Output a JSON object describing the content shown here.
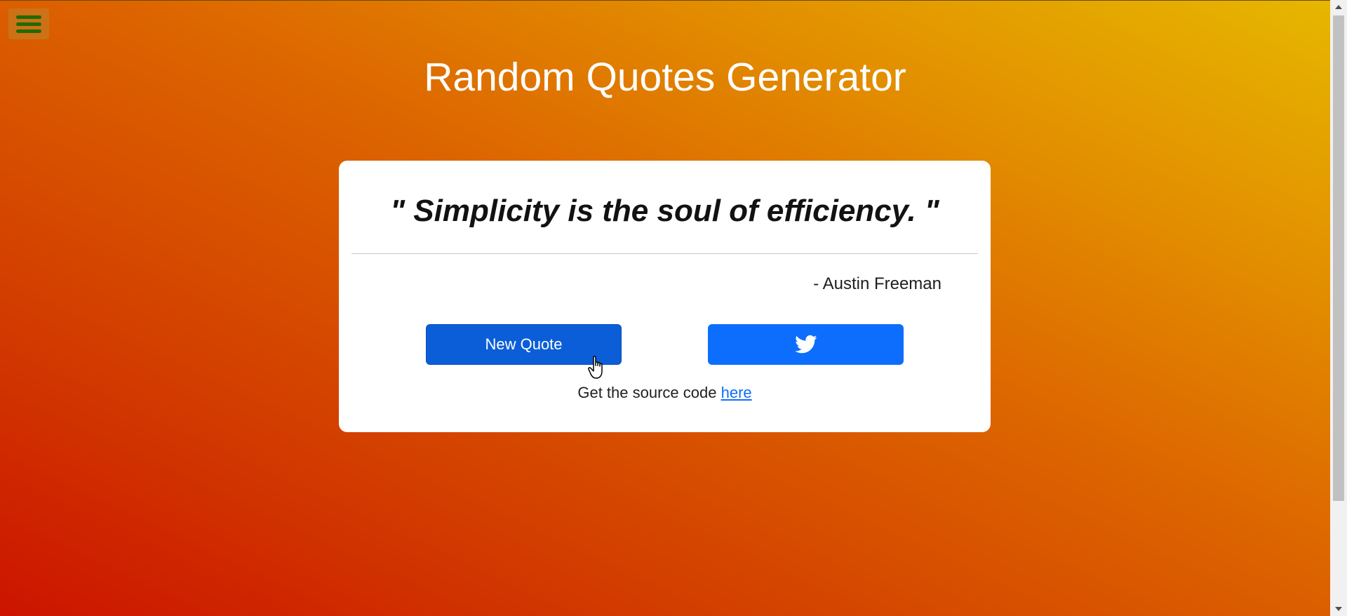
{
  "header": {
    "menu_icon": "hamburger-menu-icon",
    "title": "Random Quotes Generator"
  },
  "quote_card": {
    "quote": "\" Simplicity is the soul of efficiency. \"",
    "author": "- Austin Freeman",
    "new_quote_label": "New Quote",
    "tweet_icon": "twitter-icon",
    "source_text": "Get the source code",
    "source_link_label": "here"
  },
  "colors": {
    "gradient_start": "#cc1400",
    "gradient_end": "#e6b800",
    "primary_button": "#0b5ed7",
    "tweet_button": "#0d6efd",
    "menu_bars": "#1f6b00"
  }
}
